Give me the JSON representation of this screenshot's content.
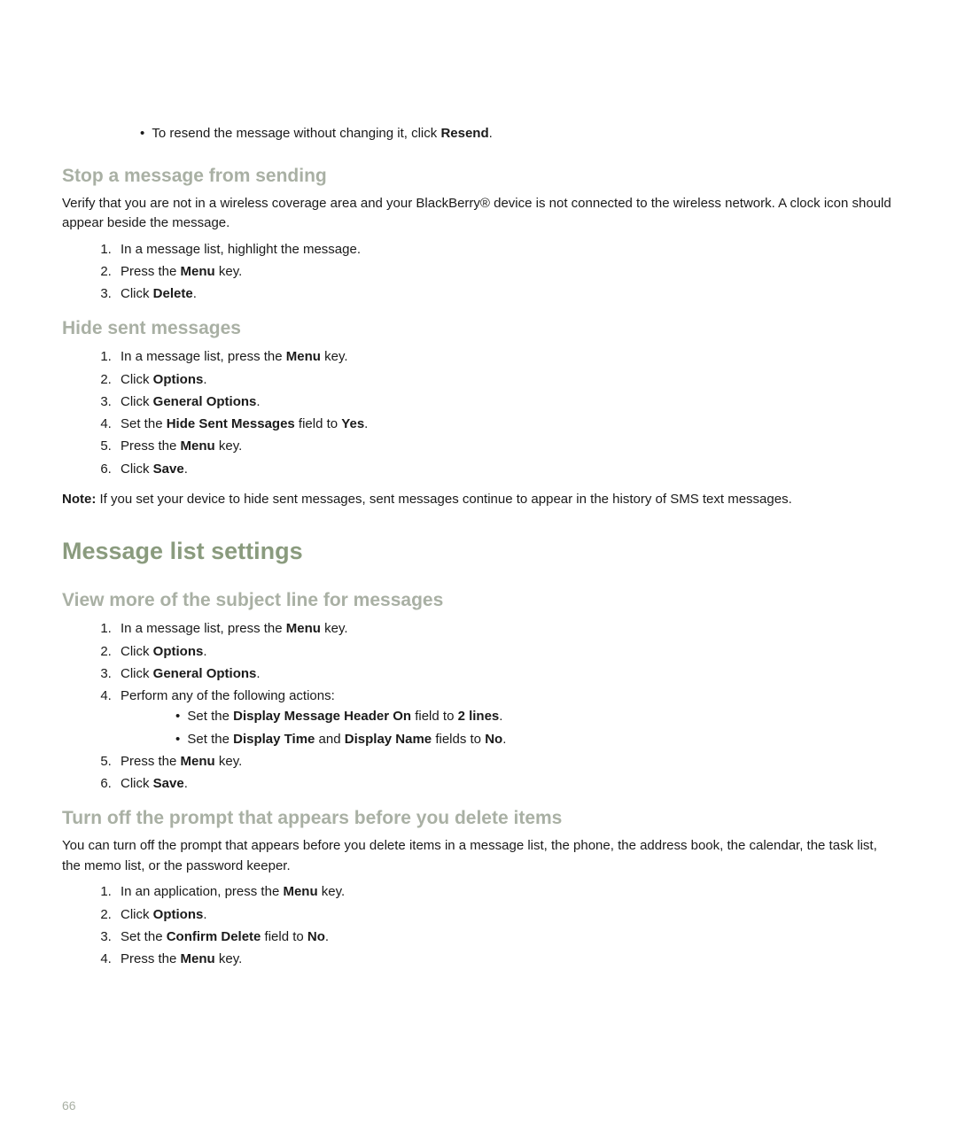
{
  "resend_bullet": {
    "prefix": "To resend the message without changing it, click ",
    "bold": "Resend",
    "suffix": "."
  },
  "section_stop": {
    "title": "Stop a message from sending",
    "intro": "Verify that you are not in a wireless coverage area and your BlackBerry® device is not connected to the wireless network. A clock icon should appear beside the message.",
    "step1": "In a message list, highlight the message.",
    "step2_pre": "Press the ",
    "step2_bold": "Menu",
    "step2_post": " key.",
    "step3_pre": "Click ",
    "step3_bold": "Delete",
    "step3_post": "."
  },
  "section_hide": {
    "title": "Hide sent messages",
    "step1_pre": "In a message list, press the ",
    "step1_bold": "Menu",
    "step1_post": " key.",
    "step2_pre": "Click ",
    "step2_bold": "Options",
    "step2_post": ".",
    "step3_pre": "Click ",
    "step3_bold": "General Options",
    "step3_post": ".",
    "step4_pre": "Set the ",
    "step4_bold1": "Hide Sent Messages",
    "step4_mid": " field to ",
    "step4_bold2": "Yes",
    "step4_post": ".",
    "step5_pre": "Press the ",
    "step5_bold": "Menu",
    "step5_post": " key.",
    "step6_pre": "Click ",
    "step6_bold": "Save",
    "step6_post": ".",
    "note_label": "Note:",
    "note_text": "  If you set your device to hide sent messages, sent messages continue to appear in the history of SMS text messages."
  },
  "major_heading": "Message list settings",
  "section_view": {
    "title": "View more of the subject line for messages",
    "step1_pre": "In a message list, press the ",
    "step1_bold": "Menu",
    "step1_post": " key.",
    "step2_pre": "Click ",
    "step2_bold": "Options",
    "step2_post": ".",
    "step3_pre": "Click ",
    "step3_bold": "General Options",
    "step3_post": ".",
    "step4": "Perform any of the following actions:",
    "sub1_pre": "Set the ",
    "sub1_bold1": "Display Message Header On",
    "sub1_mid": " field to ",
    "sub1_bold2": "2 lines",
    "sub1_post": ".",
    "sub2_pre": "Set the ",
    "sub2_bold1": "Display Time",
    "sub2_mid1": " and ",
    "sub2_bold2": "Display Name",
    "sub2_mid2": " fields to ",
    "sub2_bold3": "No",
    "sub2_post": ".",
    "step5_pre": "Press the ",
    "step5_bold": "Menu",
    "step5_post": " key.",
    "step6_pre": "Click ",
    "step6_bold": "Save",
    "step6_post": "."
  },
  "section_prompt": {
    "title": "Turn off the prompt that appears before you delete items",
    "intro": "You can turn off the prompt that appears before you delete items in a message list, the phone, the address book, the calendar, the task list, the memo list, or the password keeper.",
    "step1_pre": "In an application, press the ",
    "step1_bold": "Menu",
    "step1_post": " key.",
    "step2_pre": "Click ",
    "step2_bold": "Options",
    "step2_post": ".",
    "step3_pre": "Set the ",
    "step3_bold1": "Confirm Delete",
    "step3_mid": " field to ",
    "step3_bold2": "No",
    "step3_post": ".",
    "step4_pre": "Press the ",
    "step4_bold": "Menu",
    "step4_post": " key."
  },
  "page_number": "66"
}
